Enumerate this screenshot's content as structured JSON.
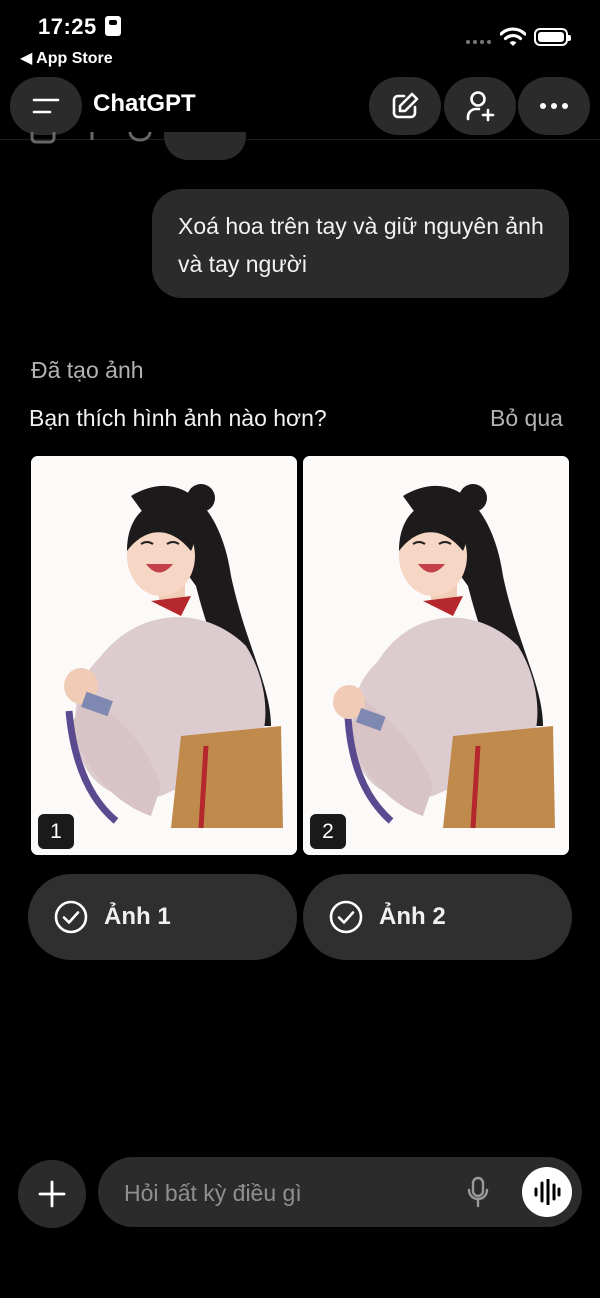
{
  "status_bar": {
    "time": "17:25",
    "back_label": "◀ App Store"
  },
  "header": {
    "title": "ChatGPT",
    "icons": {
      "menu": "menu-icon",
      "new_chat": "edit-icon",
      "add_user": "add-user-icon",
      "more": "more-icon"
    }
  },
  "chat": {
    "user_message": "Xoá hoa trên tay và giữ nguyên ảnh và tay người",
    "created_label": "Đã tạo ảnh",
    "question": "Bạn thích hình ảnh nào hơn?",
    "skip_label": "Bỏ qua",
    "images": [
      {
        "number": "1"
      },
      {
        "number": "2"
      }
    ],
    "choices": [
      {
        "label": "Ảnh 1"
      },
      {
        "label": "Ảnh 2"
      }
    ]
  },
  "composer": {
    "placeholder": "Hỏi bất kỳ điều gì",
    "icons": {
      "add": "plus-icon",
      "mic": "mic-icon",
      "voice": "voice-mode-icon"
    }
  }
}
